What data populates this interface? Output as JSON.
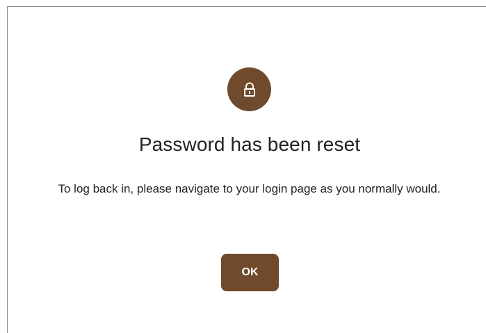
{
  "dialog": {
    "icon": "lock-icon",
    "title": "Password has been reset",
    "message": "To log back in, please navigate to your login page as you normally would.",
    "ok_label": "OK"
  },
  "colors": {
    "accent": "#6f4a2c",
    "text": "#222222",
    "background": "#ffffff"
  }
}
